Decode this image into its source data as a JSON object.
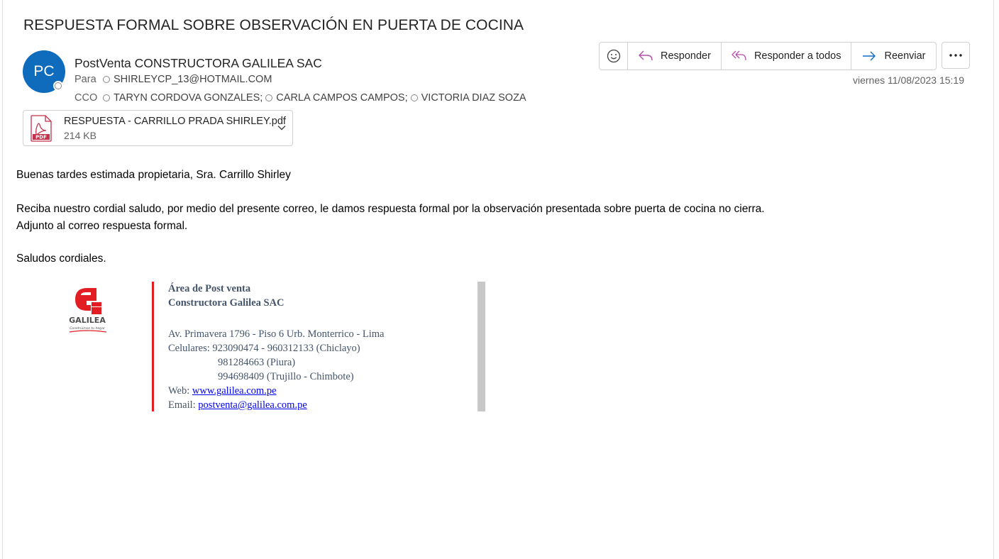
{
  "subject": "RESPUESTA FORMAL SOBRE OBSERVACIÓN EN PUERTA DE COCINA",
  "sender": {
    "initials": "PC",
    "name": "PostVenta CONSTRUCTORA GALILEA SAC",
    "avatar_color": "#0f6cbd"
  },
  "to": {
    "label": "Para",
    "recipients": [
      "SHIRLEYCP_13@HOTMAIL.COM"
    ]
  },
  "cc": {
    "label": "CCO",
    "recipients": [
      "TARYN CORDOVA GONZALES;",
      "CARLA CAMPOS CAMPOS;",
      "VICTORIA DIAZ SOZA"
    ]
  },
  "toolbar": {
    "emoji_icon": "emoji-icon",
    "reply_label": "Responder",
    "reply_all_label": "Responder a todos",
    "forward_label": "Reenviar",
    "more_icon": "more-icon"
  },
  "date": "viernes 11/08/2023 15:19",
  "attachment": {
    "name": "RESPUESTA - CARRILLO PRADA SHIRLEY.pdf",
    "size": "214 KB",
    "icon": "pdf-icon"
  },
  "body": {
    "greeting": "Buenas tardes estimada propietaria, Sra. Carrillo Shirley",
    "line1": "Reciba nuestro cordial saludo, por medio del presente correo, le damos respuesta formal por la observación presentada sobre puerta de cocina no cierra.",
    "line2": "Adjunto al correo respuesta formal.",
    "closing": "Saludos cordiales."
  },
  "signature": {
    "logo_text": "GALILEA",
    "logo_tagline": "Construimos tu hogar",
    "dept": "Área de Post venta",
    "company": "Constructora Galilea SAC",
    "address": "Av. Primavera 1796 - Piso 6 Urb. Monterrico - Lima",
    "phones_label": "Celulares:",
    "phone1": "923090474 - 960312133 (Chiclayo)",
    "phone2": "981284663 (Piura)",
    "phone3": "994698409 (Trujillo - Chimbote)",
    "web_label": "Web:",
    "web": "www.galilea.com.pe",
    "email_label": "Email:",
    "email": "postventa@galilea.com.pe",
    "accent_color": "#e21d24"
  }
}
